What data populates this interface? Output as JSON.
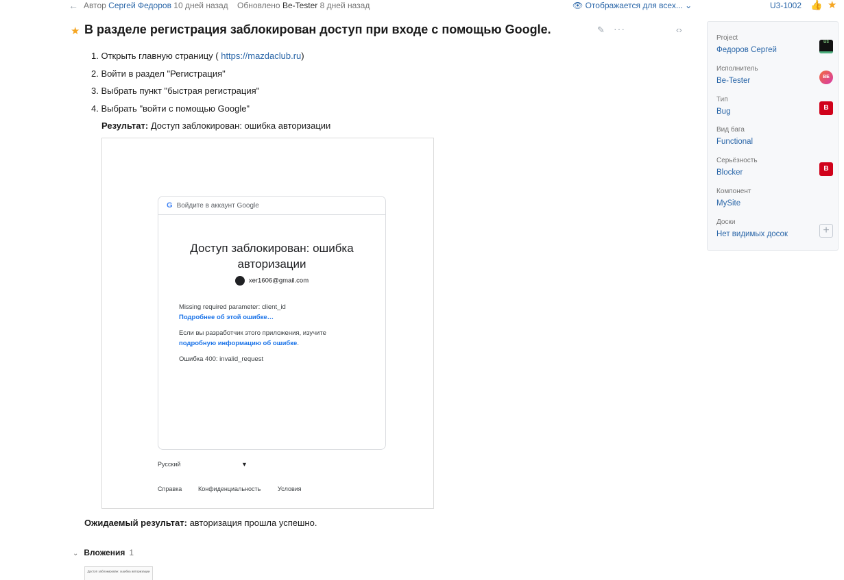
{
  "topbar": {
    "author_label": "Автор",
    "author": "Сергей Федоров",
    "created": "10 дней назад",
    "updated_label": "Обновлено",
    "updater": "Be-Tester",
    "updated": "8 дней назад",
    "visibility": "Отображается для всех...",
    "issue_id": "U3-1002"
  },
  "title": "В разделе регистрация заблокирован доступ при входе с помощью Google.",
  "steps": [
    {
      "num": "1.",
      "text": "Открыть главную страницу ( ",
      "link": "https://mazdaclub.ru",
      "tail": ")"
    },
    {
      "num": "2.",
      "text": "Войти в раздел \"Регистрация\""
    },
    {
      "num": "3.",
      "text": "Выбрать пункт \"быстрая регистрация\""
    },
    {
      "num": "4.",
      "text": "Выбрать \"войти с помощью Google\""
    }
  ],
  "result": {
    "label": "Результат:",
    "text": "Доступ заблокирован: ошибка авторизации"
  },
  "screenshot": {
    "header": "Войдите в аккаунт Google",
    "header_logo": "G",
    "title": "Доступ заблокирован: ошибка авторизации",
    "account": "xer1606@gmail.com",
    "error_line": "Missing required parameter: client_id",
    "more_link": "Подробнее об этой ошибке…",
    "dev_text": "Если вы разработчик этого приложения, изучите",
    "dev_link": "подробную информацию об ошибке",
    "dev_dot": ".",
    "error_code": "Ошибка 400: invalid_request",
    "language": "Русский",
    "footer": [
      "Справка",
      "Конфиденциальность",
      "Условия"
    ]
  },
  "expected": {
    "label": "Ожидаемый результат:",
    "text": "авторизация прошла успешно."
  },
  "attachments": {
    "label": "Вложения",
    "count": "1",
    "thumb_text": "Доступ заблокирован: ошибка авторизации"
  },
  "panel": {
    "fields": [
      {
        "label": "Project",
        "value": "Федоров Сергей",
        "icon": "U3"
      },
      {
        "label": "Исполнитель",
        "value": "Be-Tester",
        "icon": "BE"
      },
      {
        "label": "Тип",
        "value": "Bug",
        "icon": "B"
      },
      {
        "label": "Вид бага",
        "value": "Functional",
        "icon": ""
      },
      {
        "label": "Серьёзность",
        "value": "Blocker",
        "icon": "B"
      },
      {
        "label": "Компонент",
        "value": "MySite",
        "icon": ""
      },
      {
        "label": "Доски",
        "value": "Нет видимых досок",
        "icon": "+"
      }
    ]
  },
  "colors": {
    "accent": "#2a66a8",
    "star": "#f5a623",
    "badge_red": "#d0021b"
  }
}
